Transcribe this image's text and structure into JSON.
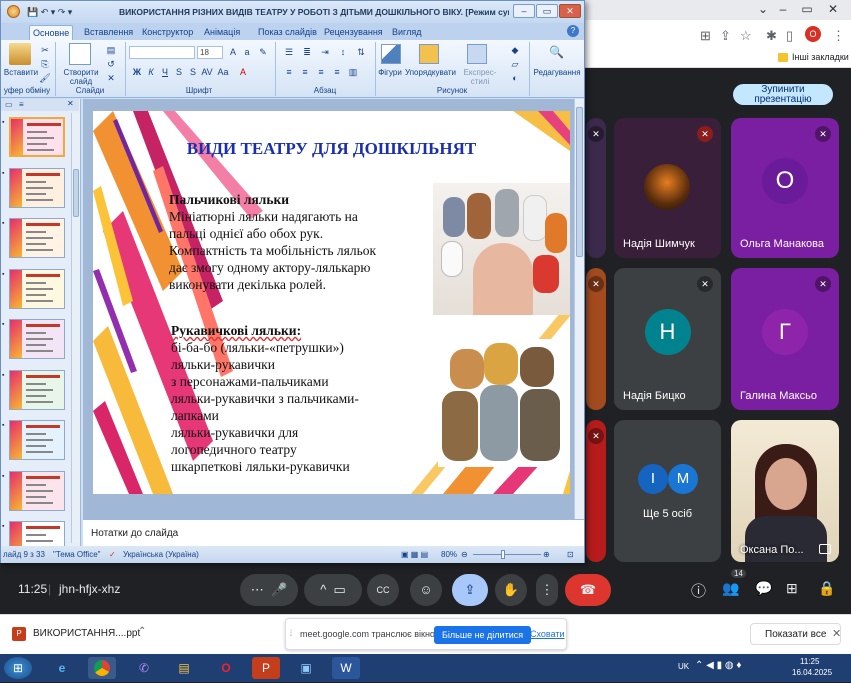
{
  "chrome": {
    "controls": {
      "min": "–",
      "restore": "▭",
      "close": "✕",
      "chevron": "⌄"
    },
    "bookmark_label": "Інші закладки",
    "profile_letter": "O"
  },
  "ppt": {
    "title": "ВИКОРИСТАННЯ РІЗНИХ ВИДІВ ТЕАТРУ У РОБОТІ З ДІТЬМИ ДОШКІЛЬНОГО ВІКУ. [Режим сумісності] - M...",
    "tabs": [
      "Основне",
      "Вставлення",
      "Конструктор",
      "Анімація",
      "Показ слайдів",
      "Рецензування",
      "Вигляд"
    ],
    "ribbon": {
      "paste": "Вставити",
      "new_slide": "Створити слайд",
      "clipboard_group": "уфер обміну",
      "slides_group": "Слайди",
      "font_group": "Шрифт",
      "paragraph_group": "Абзац",
      "drawing_group": "Рисунок",
      "font_size": "18",
      "shapes": "Фігури",
      "arrange": "Упорядкувати",
      "quick_styles": "Експрес-стилі",
      "editing": "Редагування"
    },
    "thumbnails_count": 9,
    "slide": {
      "heading": "ВИДИ ТЕАТРУ ДЛЯ ДОШКІЛЬНЯТ",
      "s1_title": "Пальчикові ляльки",
      "s1_lines": [
        "Мініатюрні ляльки надягають на",
        "пальці однієї або обох рук.",
        "Компактність та мобільність  ляльок",
        "дає змогу одному актору-лялькарю",
        "виконувати декілька  ролей."
      ],
      "s2_title": "Рукавичкові ляльки:",
      "s2_lines": [
        "бі-ба-бо (ляльки-«петрушки»)",
        "ляльки-рукавички",
        "з персонажами-пальчиками",
        "ляльки-рукавички з пальчиками-",
        "лапками",
        "ляльки-рукавички для",
        "логопедичного театру",
        "шкарпеткові ляльки-рукавички"
      ]
    },
    "notes": "Нотатки до слайда",
    "status": {
      "slide": "лайд 9 з 33",
      "theme": "\"Тема Office\"",
      "lang": "Українська (Україна)",
      "zoom": "80%"
    }
  },
  "meet": {
    "stop_button": "Зупинити презентацію",
    "participants": [
      {
        "name": "Надія Шимчук",
        "letter": "",
        "color": "#8e24aa"
      },
      {
        "name": "Ольга Манакова",
        "letter": "О",
        "color": "#7b1fa2"
      },
      {
        "name": "Надія Бицко",
        "letter": "Н",
        "color": "#00838f"
      },
      {
        "name": "Галина Максьо",
        "letter": "Г",
        "color": "#8e24aa"
      },
      {
        "name": "Ще 5 осіб",
        "letter": "",
        "color": ""
      },
      {
        "name": "Оксана По...",
        "letter": "",
        "color": ""
      }
    ],
    "more_avatars": [
      "І",
      "М"
    ],
    "time": "11:25",
    "meeting_code": "jhn-hfjx-xhz",
    "badge_count": "14"
  },
  "download": {
    "file": "ВИКОРИСТАННЯ....ppt",
    "share_msg": "meet.google.com транслює вікно.",
    "stop_share": "Більше не ділитися",
    "hide": "Сховати",
    "show_all": "Показати все"
  },
  "taskbar": {
    "lang": "UK",
    "time": "11:25",
    "date": "16.04.2025"
  }
}
